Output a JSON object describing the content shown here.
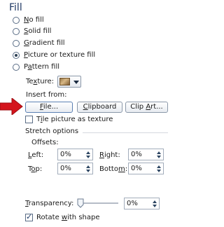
{
  "section_title": "Fill",
  "fill_options": [
    {
      "label": "No fill",
      "key": "N",
      "rest": "o fill",
      "selected": false
    },
    {
      "label": "Solid fill",
      "key": "S",
      "rest": "olid fill",
      "selected": false
    },
    {
      "label": "Gradient fill",
      "key": "G",
      "rest": "radient fill",
      "selected": false
    },
    {
      "label": "Picture or texture fill",
      "key": "P",
      "rest": "icture or texture fill",
      "selected": true
    },
    {
      "label": "Pattern fill",
      "key": "",
      "rest": "",
      "selected": false
    }
  ],
  "pattern_fill": {
    "pre": "P",
    "key": "a",
    "rest": "ttern fill"
  },
  "texture": {
    "pre": "Te",
    "key": "x",
    "rest": "ture:"
  },
  "insert_from": "Insert from:",
  "buttons": {
    "file": {
      "key": "F",
      "rest": "ile..."
    },
    "clipboard": {
      "key": "C",
      "rest": "lipboard"
    },
    "clip_art": {
      "pre": "Clip ",
      "key": "A",
      "rest": "rt..."
    }
  },
  "tile": {
    "pre": "T",
    "key": "i",
    "rest": "le picture as texture",
    "checked": false
  },
  "stretch_options": "Stretch options",
  "offsets": "Offsets:",
  "left": {
    "key": "L",
    "rest": "eft:",
    "value": "0%"
  },
  "right": {
    "key": "R",
    "rest": "ight:",
    "value": "0%"
  },
  "top": {
    "pre": "T",
    "key": "o",
    "rest": "p:",
    "value": "0%"
  },
  "bottom": {
    "pre": "Botto",
    "key": "m",
    "rest": ":",
    "value": "0%"
  },
  "transparency": {
    "key": "T",
    "rest": "ransparency:",
    "value": "0%",
    "level_percent": 0
  },
  "rotate": {
    "pre": "Rotate ",
    "key": "w",
    "rest": "ith shape",
    "checked": true
  },
  "colors": {
    "arrow": "#d4141c",
    "title": "#1f3864"
  }
}
